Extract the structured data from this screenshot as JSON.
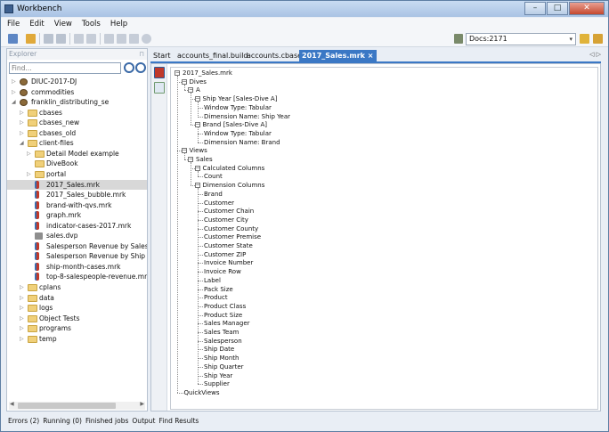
{
  "window": {
    "title": "Workbench"
  },
  "menu": [
    "File",
    "Edit",
    "View",
    "Tools",
    "Help"
  ],
  "toolbar": {
    "docs_value": "Docs:2171"
  },
  "explorer": {
    "header": "Explorer",
    "find_placeholder": "Find...",
    "items": [
      {
        "label": "DIUC-2017-DJ",
        "type": "bundle",
        "depth": 0,
        "expander": "▷"
      },
      {
        "label": "commodities",
        "type": "bundle",
        "depth": 0,
        "expander": "▷"
      },
      {
        "label": "franklin_distributing_se",
        "type": "bundle",
        "depth": 0,
        "expander": "◢"
      },
      {
        "label": "cbases",
        "type": "folder",
        "depth": 1,
        "expander": "▷"
      },
      {
        "label": "cbases_new",
        "type": "folder",
        "depth": 1,
        "expander": "▷"
      },
      {
        "label": "cbases_old",
        "type": "folder",
        "depth": 1,
        "expander": "▷"
      },
      {
        "label": "client-files",
        "type": "folder",
        "depth": 1,
        "expander": "◢"
      },
      {
        "label": "Detail Model example",
        "type": "folder",
        "depth": 2,
        "expander": "▷"
      },
      {
        "label": "DiveBook",
        "type": "folder",
        "depth": 2,
        "expander": ""
      },
      {
        "label": "portal",
        "type": "folder",
        "depth": 2,
        "expander": "▷"
      },
      {
        "label": "2017_Sales.mrk",
        "type": "mrk",
        "depth": 2,
        "expander": "",
        "selected": true
      },
      {
        "label": "2017_Sales_bubble.mrk",
        "type": "mrk",
        "depth": 2,
        "expander": ""
      },
      {
        "label": "brand-with-qvs.mrk",
        "type": "mrk",
        "depth": 2,
        "expander": ""
      },
      {
        "label": "graph.mrk",
        "type": "mrk",
        "depth": 2,
        "expander": ""
      },
      {
        "label": "indicator-cases-2017.mrk",
        "type": "mrk",
        "depth": 2,
        "expander": ""
      },
      {
        "label": "sales.dvp",
        "type": "dvp",
        "depth": 2,
        "expander": ""
      },
      {
        "label": "Salesperson Revenue by Sales Mar",
        "type": "mrk",
        "depth": 2,
        "expander": ""
      },
      {
        "label": "Salesperson Revenue by Ship Mor",
        "type": "mrk",
        "depth": 2,
        "expander": ""
      },
      {
        "label": "ship-month-cases.mrk",
        "type": "mrk",
        "depth": 2,
        "expander": ""
      },
      {
        "label": "top-8-salespeople-revenue.mrk",
        "type": "mrk",
        "depth": 2,
        "expander": ""
      },
      {
        "label": "cplans",
        "type": "folder",
        "depth": 1,
        "expander": "▷"
      },
      {
        "label": "data",
        "type": "folder",
        "depth": 1,
        "expander": "▷"
      },
      {
        "label": "logs",
        "type": "folder",
        "depth": 1,
        "expander": "▷"
      },
      {
        "label": "Object Tests",
        "type": "folder",
        "depth": 1,
        "expander": "▷"
      },
      {
        "label": "programs",
        "type": "folder",
        "depth": 1,
        "expander": "▷"
      },
      {
        "label": "temp",
        "type": "folder",
        "depth": 1,
        "expander": "▷"
      }
    ]
  },
  "tabs": [
    {
      "label": "Start"
    },
    {
      "label": "accounts_final.build"
    },
    {
      "label": "accounts.cbase"
    },
    {
      "label": "2017_Sales.mrk",
      "active": true
    }
  ],
  "tab_close": "×",
  "status": [
    "Errors (2)",
    "Running (0)",
    "Finished jobs",
    "Output",
    "Find Results"
  ],
  "doc_tree": [
    {
      "label": "2017_Sales.mrk",
      "depth": 0,
      "box": "−"
    },
    {
      "label": "Dives",
      "depth": 1,
      "box": "−"
    },
    {
      "label": "A",
      "depth": 2,
      "box": "−"
    },
    {
      "label": "Ship Year [Sales-Dive A]",
      "depth": 3,
      "box": "−"
    },
    {
      "label": "Window Type: Tabular",
      "depth": 4,
      "box": ""
    },
    {
      "label": "Dimension Name: Ship Year",
      "depth": 4,
      "box": ""
    },
    {
      "label": "Brand [Sales-Dive A]",
      "depth": 3,
      "box": "−"
    },
    {
      "label": "Window Type: Tabular",
      "depth": 4,
      "box": ""
    },
    {
      "label": "Dimension Name: Brand",
      "depth": 4,
      "box": ""
    },
    {
      "label": "Views",
      "depth": 1,
      "box": "−"
    },
    {
      "label": "Sales",
      "depth": 2,
      "box": "−"
    },
    {
      "label": "Calculated Columns",
      "depth": 3,
      "box": "−"
    },
    {
      "label": "Count",
      "depth": 4,
      "box": ""
    },
    {
      "label": "Dimension Columns",
      "depth": 3,
      "box": "−"
    },
    {
      "label": "Brand",
      "depth": 4,
      "box": ""
    },
    {
      "label": "Customer",
      "depth": 4,
      "box": ""
    },
    {
      "label": "Customer Chain",
      "depth": 4,
      "box": ""
    },
    {
      "label": "Customer City",
      "depth": 4,
      "box": ""
    },
    {
      "label": "Customer County",
      "depth": 4,
      "box": ""
    },
    {
      "label": "Customer Premise",
      "depth": 4,
      "box": ""
    },
    {
      "label": "Customer State",
      "depth": 4,
      "box": ""
    },
    {
      "label": "Customer ZIP",
      "depth": 4,
      "box": ""
    },
    {
      "label": "Invoice Number",
      "depth": 4,
      "box": ""
    },
    {
      "label": "Invoice Row",
      "depth": 4,
      "box": ""
    },
    {
      "label": "Label",
      "depth": 4,
      "box": ""
    },
    {
      "label": "Pack Size",
      "depth": 4,
      "box": ""
    },
    {
      "label": "Product",
      "depth": 4,
      "box": ""
    },
    {
      "label": "Product Class",
      "depth": 4,
      "box": ""
    },
    {
      "label": "Product Size",
      "depth": 4,
      "box": ""
    },
    {
      "label": "Sales Manager",
      "depth": 4,
      "box": ""
    },
    {
      "label": "Sales Team",
      "depth": 4,
      "box": ""
    },
    {
      "label": "Salesperson",
      "depth": 4,
      "box": ""
    },
    {
      "label": "Ship Date",
      "depth": 4,
      "box": ""
    },
    {
      "label": "Ship Month",
      "depth": 4,
      "box": ""
    },
    {
      "label": "Ship Quarter",
      "depth": 4,
      "box": ""
    },
    {
      "label": "Ship Year",
      "depth": 4,
      "box": ""
    },
    {
      "label": "Supplier",
      "depth": 4,
      "box": ""
    },
    {
      "label": "QuickViews",
      "depth": 1,
      "box": ""
    }
  ]
}
